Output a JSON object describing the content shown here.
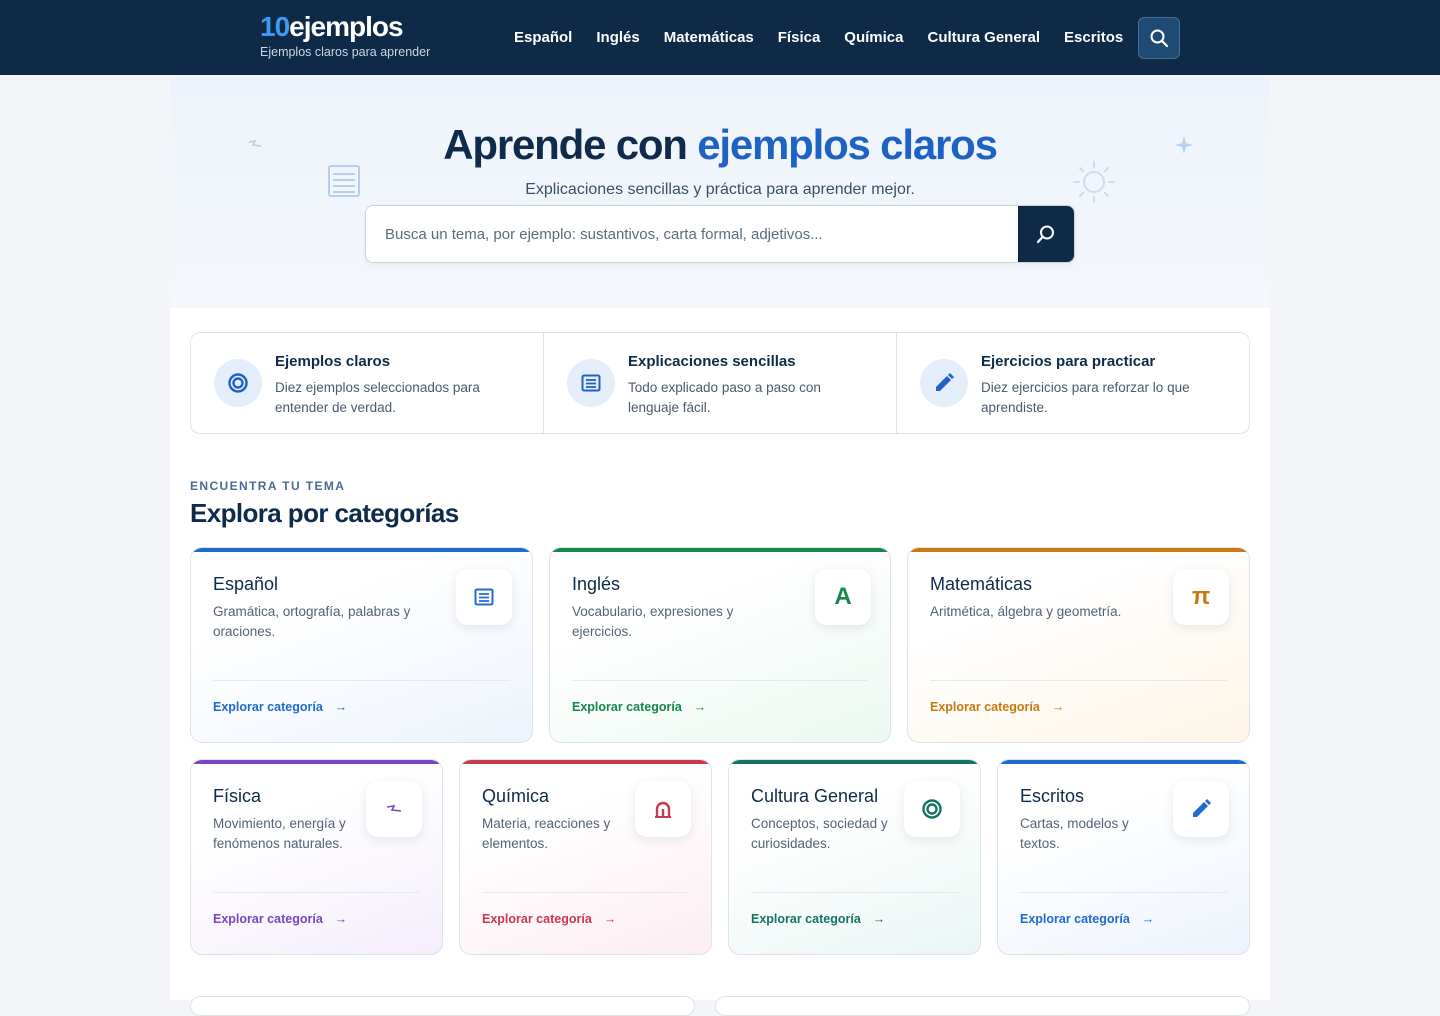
{
  "header": {
    "logo_number": "10",
    "logo_word": "ejemplos",
    "tagline": "Ejemplos claros para aprender",
    "nav": [
      "Español",
      "Inglés",
      "Matemáticas",
      "Física",
      "Química",
      "Cultura General",
      "Escritos"
    ],
    "search_icon": "search-icon"
  },
  "hero": {
    "title_plain": "Aprende con",
    "title_accent": "ejemplos claros",
    "subtitle": "Explicaciones sencillas y práctica para aprender mejor.",
    "search_placeholder": "Busca un tema, por ejemplo: sustantivos, carta formal, adjetivos...",
    "search_button_icon": "search-icon"
  },
  "features": [
    {
      "icon": "target-icon",
      "title": "Ejemplos claros",
      "desc": "Diez ejemplos seleccionados para entender de verdad."
    },
    {
      "icon": "list-icon",
      "title": "Explicaciones sencillas",
      "desc": "Todo explicado paso a paso con lenguaje fácil."
    },
    {
      "icon": "pencil-icon",
      "title": "Ejercicios para practicar",
      "desc": "Diez ejercicios para reforzar lo que aprendiste."
    }
  ],
  "section": {
    "eyebrow": "ENCUENTRA TU TEMA",
    "title": "Explora por categorías"
  },
  "categories": [
    {
      "name": "Español",
      "desc": "Gramática, ortografía, palabras y oraciones.",
      "icon": "list-icon",
      "glyph": "",
      "color": "#1e6ccf",
      "link": "Explorar categoría",
      "arrow": "→"
    },
    {
      "name": "Inglés",
      "desc": "Vocabulario, expresiones y ejercicios.",
      "icon": "letter-a-icon",
      "glyph": "A",
      "color": "#17874b",
      "link": "Explorar categoría",
      "arrow": "→"
    },
    {
      "name": "Matemáticas",
      "desc": "Aritmética, álgebra y geometría.",
      "icon": "pi-icon",
      "glyph": "π",
      "color": "#c87a12",
      "link": "Explorar categoría",
      "arrow": "→"
    },
    {
      "name": "Física",
      "desc": "Movimiento, energía y fenómenos naturales.",
      "icon": "lightning-icon",
      "glyph": "",
      "color": "#7a45c2",
      "link": "Explorar categoría",
      "arrow": "→"
    },
    {
      "name": "Química",
      "desc": "Materia, reacciones y elementos.",
      "icon": "flask-icon",
      "glyph": "",
      "color": "#c9394f",
      "link": "Explorar categoría",
      "arrow": "→"
    },
    {
      "name": "Cultura General",
      "desc": "Conceptos, sociedad y curiosidades.",
      "icon": "globe-icon",
      "glyph": "",
      "color": "#137466",
      "link": "Explorar categoría",
      "arrow": "→"
    },
    {
      "name": "Escritos",
      "desc": "Cartas, modelos y textos.",
      "icon": "pencil-icon",
      "glyph": "",
      "color": "#1e6ccf",
      "link": "Explorar categoría",
      "arrow": "→"
    }
  ]
}
